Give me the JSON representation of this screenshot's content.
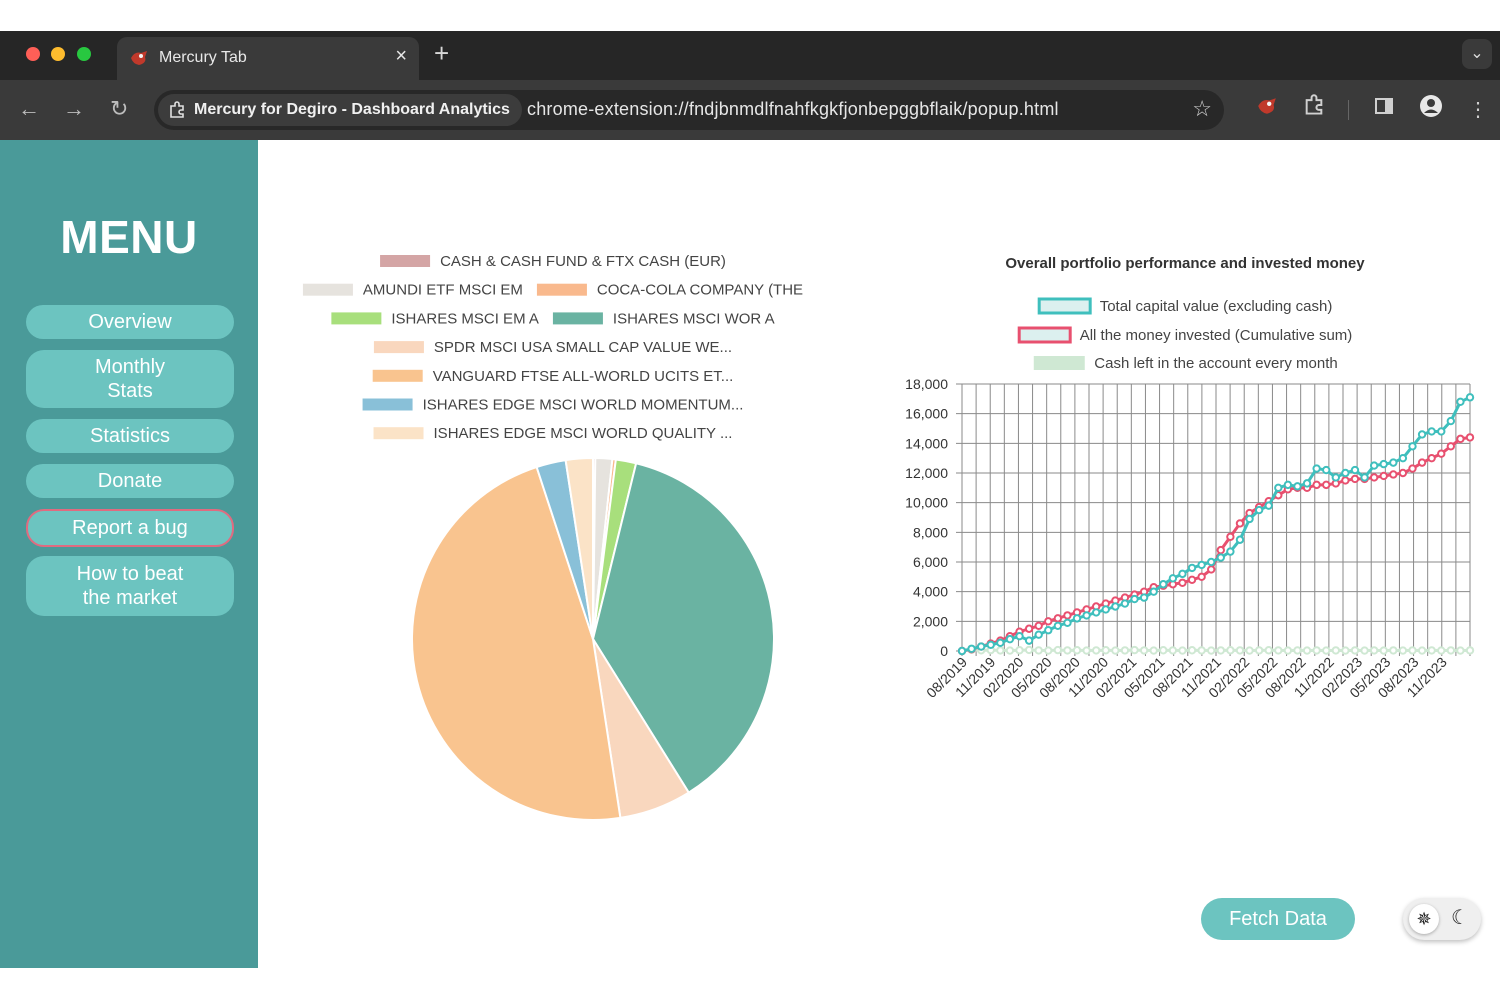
{
  "browser": {
    "tab_title": "Mercury Tab",
    "tab_close": "×",
    "new_tab": "+",
    "tab_menu": "⌄",
    "site_chip": "Mercury for Degiro - Dashboard Analytics",
    "url": "chrome-extension://fndjbnmdlfnahfkgkfjonbepggbflaik/popup.html",
    "icons": [
      "back-icon",
      "forward-icon",
      "reload-icon",
      "star-icon",
      "extension-favicon-icon",
      "puzzle-icon",
      "side-panel-icon",
      "profile-icon",
      "more-icon"
    ],
    "back": "←",
    "forward": "→",
    "reload": "↻",
    "star": "☆",
    "more": "⋮"
  },
  "sidebar": {
    "title": "MENU",
    "items": [
      {
        "label": "Overview"
      },
      {
        "label": "Monthly\nStats"
      },
      {
        "label": "Statistics"
      },
      {
        "label": "Donate"
      },
      {
        "label": "Report a bug"
      },
      {
        "label": "How to beat\nthe market"
      }
    ]
  },
  "buttons": {
    "fetch": "Fetch Data",
    "theme_sun": "✵",
    "theme_moon": "☾"
  },
  "colors": {
    "sidebar": "#4a9a99",
    "button": "#6cc4c0",
    "series_total": "#3fbfbd",
    "series_invested": "#e8506f",
    "series_cash": "#cfe8d3"
  },
  "chart_data": [
    {
      "type": "pie",
      "title": "",
      "legend_position": "top",
      "slices": [
        {
          "label": "CASH & CASH FUND & FTX CASH (EUR)",
          "value": 0.2,
          "color": "#d4a5a5"
        },
        {
          "label": "AMUNDI ETF MSCI EM",
          "value": 1.5,
          "color": "#e6e3de"
        },
        {
          "label": "COCA-COLA COMPANY (THE",
          "value": 0.3,
          "color": "#f9b98d"
        },
        {
          "label": "ISHARES MSCI EM A",
          "value": 1.8,
          "color": "#a8df7c"
        },
        {
          "label": "ISHARES MSCI WOR A",
          "value": 37.0,
          "color": "#6ab3a2"
        },
        {
          "label": "SPDR MSCI USA SMALL CAP VALUE WE...",
          "value": 6.4,
          "color": "#f9d7be"
        },
        {
          "label": "VANGUARD FTSE ALL-WORLD UCITS ET...",
          "value": 47.0,
          "color": "#f9c48f"
        },
        {
          "label": "ISHARES EDGE MSCI WORLD MOMENTUM...",
          "value": 2.6,
          "color": "#89c0d8"
        },
        {
          "label": "ISHARES EDGE MSCI WORLD QUALITY ...",
          "value": 2.4,
          "color": "#fbe3c7"
        }
      ]
    },
    {
      "type": "line",
      "title": "Overall portfolio performance and invested money",
      "xlabel": "",
      "ylabel": "",
      "ylim": [
        0,
        18000
      ],
      "yticks": [
        "18,000",
        "16,000",
        "14,000",
        "12,000",
        "10,000",
        "8,000",
        "6,000",
        "4,000",
        "2,000",
        "0"
      ],
      "xtick_labels": [
        "08/2019",
        "11/2019",
        "02/2020",
        "05/2020",
        "08/2020",
        "11/2020",
        "02/2021",
        "05/2021",
        "08/2021",
        "11/2021",
        "02/2022",
        "05/2022",
        "08/2022",
        "11/2022",
        "02/2023",
        "05/2023",
        "08/2023",
        "11/2023"
      ],
      "x_start": "08/2019",
      "x_end": "01/2024",
      "grid": true,
      "legend_position": "top",
      "series": [
        {
          "name": "Total capital value (excluding cash)",
          "color": "#3fbfbd",
          "values": [
            0,
            150,
            300,
            420,
            550,
            800,
            1000,
            700,
            1100,
            1400,
            1700,
            1900,
            2200,
            2400,
            2600,
            2800,
            3000,
            3200,
            3500,
            3600,
            4000,
            4500,
            4900,
            5200,
            5600,
            5800,
            6000,
            6300,
            6700,
            7500,
            8900,
            9500,
            9800,
            11000,
            11200,
            11100,
            11300,
            12300,
            12200,
            11700,
            12000,
            12200,
            11700,
            12500,
            12600,
            12700,
            13000,
            13800,
            14600,
            14800,
            14800,
            15500,
            16800,
            17100
          ]
        },
        {
          "name": "All the money invested (Cumulative sum)",
          "color": "#e8506f",
          "values": [
            0,
            120,
            300,
            500,
            700,
            1000,
            1300,
            1500,
            1700,
            2000,
            2200,
            2400,
            2600,
            2800,
            3000,
            3200,
            3400,
            3600,
            3800,
            4000,
            4300,
            4400,
            4500,
            4600,
            4800,
            5000,
            5500,
            6800,
            7700,
            8600,
            9300,
            9700,
            10100,
            10500,
            10900,
            11000,
            11000,
            11200,
            11200,
            11300,
            11500,
            11600,
            11600,
            11700,
            11800,
            11900,
            12000,
            12300,
            12700,
            13000,
            13300,
            13800,
            14300,
            14400
          ]
        },
        {
          "name": "Cash left in the account every month",
          "color": "#cfe8d3",
          "values": [
            0,
            80,
            50,
            60,
            40,
            30,
            50,
            70,
            40,
            30,
            60,
            40,
            50,
            30,
            40,
            50,
            30,
            40,
            60,
            40,
            30,
            50,
            40,
            30,
            50,
            40,
            30,
            40,
            50,
            40,
            30,
            40,
            50,
            40,
            30,
            40,
            30,
            40,
            30,
            40,
            30,
            40,
            30,
            40,
            30,
            40,
            30,
            40,
            30,
            40,
            30,
            40,
            30,
            40
          ]
        }
      ]
    }
  ]
}
